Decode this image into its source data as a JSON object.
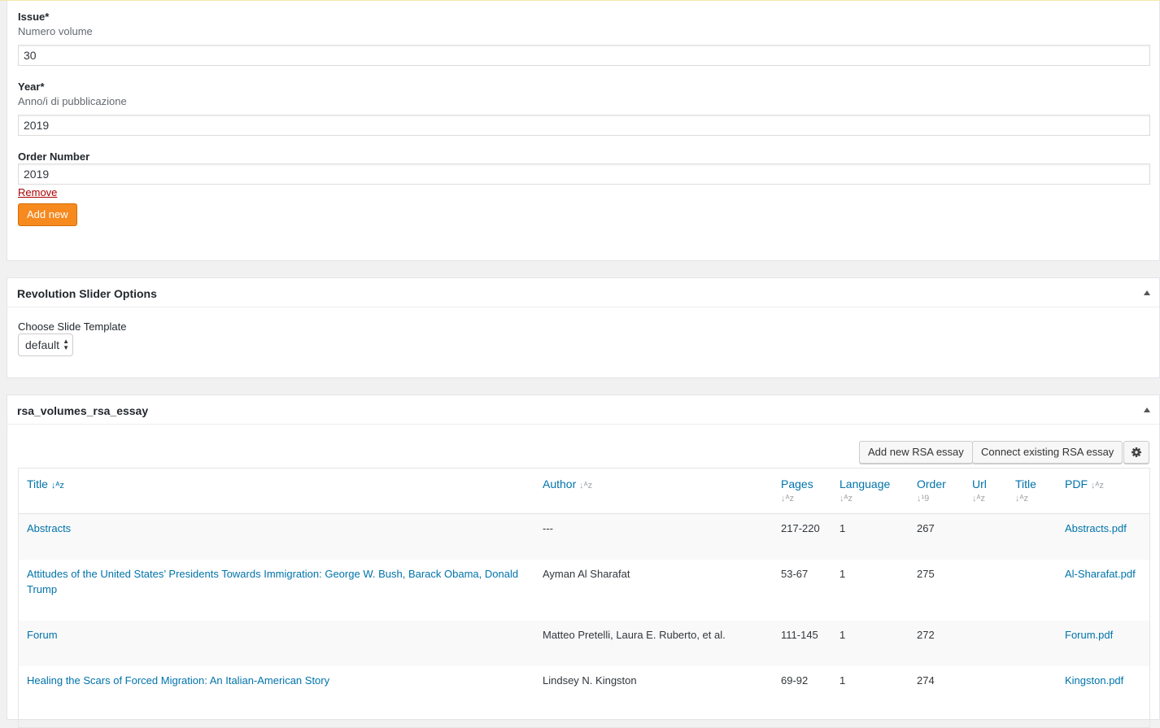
{
  "fields": {
    "issue_label": "Issue*",
    "issue_desc": "Numero volume",
    "issue_value": "30",
    "year_label": "Year*",
    "year_desc": "Anno/i di pubblicazione",
    "year_value": "2019",
    "order_label": "Order Number",
    "order_value": "2019",
    "remove_label": "Remove",
    "add_new_label": "Add new"
  },
  "slider_panel": {
    "title": "Revolution Slider Options",
    "choose_label": "Choose Slide Template",
    "selected": "default"
  },
  "essay_panel": {
    "title": "rsa_volumes_rsa_essay",
    "add_new_essay": "Add new RSA essay",
    "connect_existing": "Connect existing RSA essay",
    "columns": [
      "Title",
      "Author",
      "Pages",
      "Language",
      "Order",
      "Url",
      "Title",
      "PDF"
    ],
    "rows": [
      {
        "title": "Abstracts",
        "author": "---",
        "pages": "217-220",
        "language": "1",
        "order": "267",
        "pdf": "Abstracts.pdf"
      },
      {
        "title": "Attitudes of the United States’ Presidents Towards Immigration: George W. Bush, Barack Obama, Donald Trump",
        "author": "Ayman Al Sharafat",
        "pages": "53-67",
        "language": "1",
        "order": "275",
        "pdf": "Al-Sharafat.pdf"
      },
      {
        "title": "Forum",
        "author": "Matteo Pretelli, Laura E. Ruberto, et al.",
        "pages": "111-145",
        "language": "1",
        "order": "272",
        "pdf": "Forum.pdf"
      },
      {
        "title": "Healing the Scars of Forced Migration: An Italian-American Story",
        "author": "Lindsey N. Kingston",
        "pages": "69-92",
        "language": "1",
        "order": "274",
        "pdf": "Kingston.pdf"
      }
    ]
  },
  "icons": {
    "gear": "gear-icon",
    "collapse": "triangle-up-icon",
    "sort": "sort-alpha-icon"
  },
  "colors": {
    "link": "#0073aa",
    "accent_button": "#f68a1f",
    "remove": "#aa0000"
  }
}
